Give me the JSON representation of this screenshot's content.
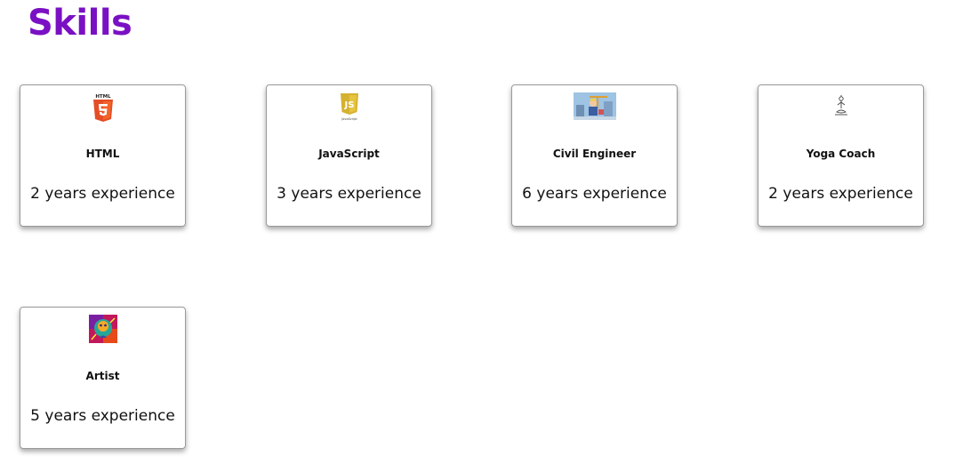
{
  "page": {
    "title": "Skills",
    "title_color": "#7a10c3"
  },
  "skills": [
    {
      "name": "HTML",
      "experience": "2 years experience",
      "icon": "html5-logo-icon"
    },
    {
      "name": "JavaScript",
      "experience": "3 years experience",
      "icon": "javascript-logo-icon"
    },
    {
      "name": "Civil Engineer",
      "experience": "6 years experience",
      "icon": "civil-engineer-illustration-icon"
    },
    {
      "name": "Yoga Coach",
      "experience": "2 years experience",
      "icon": "yoga-pose-icon"
    },
    {
      "name": "Artist",
      "experience": "5 years experience",
      "icon": "colorful-portrait-art-icon"
    }
  ]
}
